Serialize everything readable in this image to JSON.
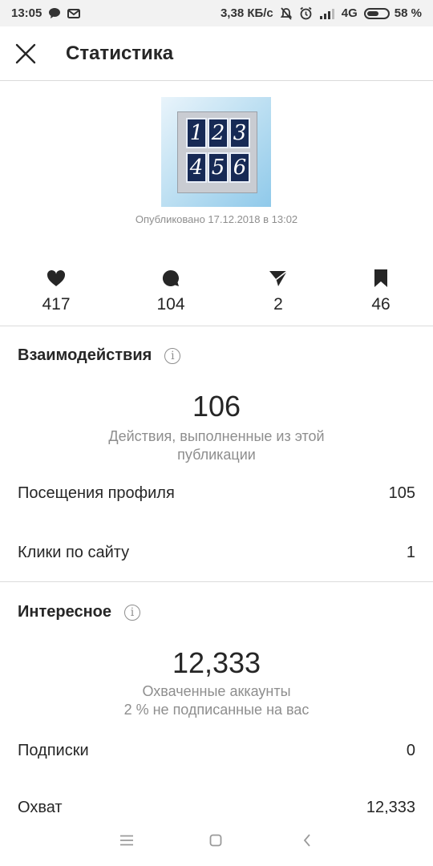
{
  "status_bar": {
    "time": "13:05",
    "speed": "3,38 КБ/с",
    "network": "4G",
    "battery": "58 %",
    "battery_level": 0.58
  },
  "header": {
    "title": "Статистика",
    "close_icon": "close-icon"
  },
  "post": {
    "thumbnail_digits": [
      "1",
      "2",
      "3",
      "4",
      "5",
      "6"
    ],
    "published": "Опубликовано 17.12.2018 в 13:02"
  },
  "stats": [
    {
      "icon": "heart-icon",
      "value": "417"
    },
    {
      "icon": "comment-icon",
      "value": "104"
    },
    {
      "icon": "send-icon",
      "value": "2"
    },
    {
      "icon": "bookmark-icon",
      "value": "46"
    }
  ],
  "interactions": {
    "title": "Взаимодействия",
    "total": "106",
    "caption_line1": "Действия, выполненные из этой",
    "caption_line2": "публикации",
    "rows": [
      {
        "label": "Посещения профиля",
        "value": "105"
      },
      {
        "label": "Клики по сайту",
        "value": "1"
      }
    ]
  },
  "discovery": {
    "title": "Интересное",
    "total": "12,333",
    "caption_line1": "Охваченные аккаунты",
    "caption_line2": "2 % не подписанные на вас",
    "rows": [
      {
        "label": "Подписки",
        "value": "0"
      },
      {
        "label": "Охват",
        "value": "12,333"
      }
    ]
  },
  "colors": {
    "text": "#262626",
    "secondary": "#8e8e8e",
    "divider": "#dbdbdb"
  }
}
